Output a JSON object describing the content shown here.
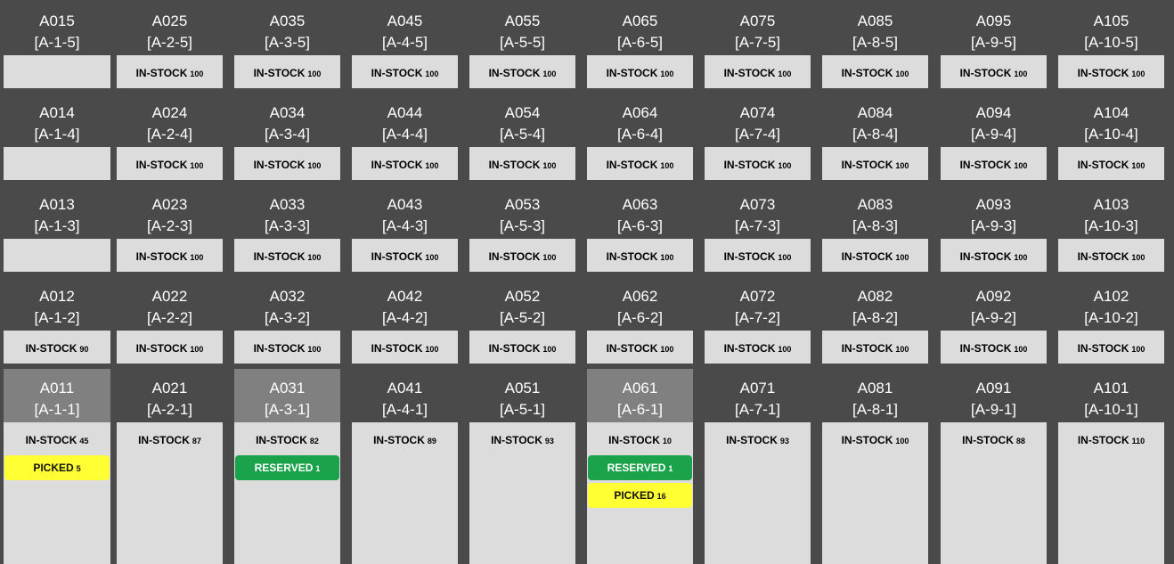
{
  "status_colors": {
    "in_stock": "#9ee8c6",
    "reserved": "#1aa34a",
    "picked": "#ffff33",
    "header_highlight": "#808080"
  },
  "rows": [
    [
      {
        "id": "A015",
        "loc": "[A-1-5]",
        "badges": []
      },
      {
        "id": "A025",
        "loc": "[A-2-5]",
        "badges": [
          {
            "type": "in-stock",
            "label": "IN-STOCK",
            "qty": "100"
          }
        ]
      },
      {
        "id": "A035",
        "loc": "[A-3-5]",
        "badges": [
          {
            "type": "in-stock",
            "label": "IN-STOCK",
            "qty": "100"
          }
        ]
      },
      {
        "id": "A045",
        "loc": "[A-4-5]",
        "badges": [
          {
            "type": "in-stock",
            "label": "IN-STOCK",
            "qty": "100"
          }
        ]
      },
      {
        "id": "A055",
        "loc": "[A-5-5]",
        "badges": [
          {
            "type": "in-stock",
            "label": "IN-STOCK",
            "qty": "100"
          }
        ]
      },
      {
        "id": "A065",
        "loc": "[A-6-5]",
        "badges": [
          {
            "type": "in-stock",
            "label": "IN-STOCK",
            "qty": "100"
          }
        ]
      },
      {
        "id": "A075",
        "loc": "[A-7-5]",
        "badges": [
          {
            "type": "in-stock",
            "label": "IN-STOCK",
            "qty": "100"
          }
        ]
      },
      {
        "id": "A085",
        "loc": "[A-8-5]",
        "badges": [
          {
            "type": "in-stock",
            "label": "IN-STOCK",
            "qty": "100"
          }
        ]
      },
      {
        "id": "A095",
        "loc": "[A-9-5]",
        "badges": [
          {
            "type": "in-stock",
            "label": "IN-STOCK",
            "qty": "100"
          }
        ]
      },
      {
        "id": "A105",
        "loc": "[A-10-5]",
        "badges": [
          {
            "type": "in-stock",
            "label": "IN-STOCK",
            "qty": "100"
          }
        ]
      }
    ],
    [
      {
        "id": "A014",
        "loc": "[A-1-4]",
        "badges": []
      },
      {
        "id": "A024",
        "loc": "[A-2-4]",
        "badges": [
          {
            "type": "in-stock",
            "label": "IN-STOCK",
            "qty": "100"
          }
        ]
      },
      {
        "id": "A034",
        "loc": "[A-3-4]",
        "badges": [
          {
            "type": "in-stock",
            "label": "IN-STOCK",
            "qty": "100"
          }
        ]
      },
      {
        "id": "A044",
        "loc": "[A-4-4]",
        "badges": [
          {
            "type": "in-stock",
            "label": "IN-STOCK",
            "qty": "100"
          }
        ]
      },
      {
        "id": "A054",
        "loc": "[A-5-4]",
        "badges": [
          {
            "type": "in-stock",
            "label": "IN-STOCK",
            "qty": "100"
          }
        ]
      },
      {
        "id": "A064",
        "loc": "[A-6-4]",
        "badges": [
          {
            "type": "in-stock",
            "label": "IN-STOCK",
            "qty": "100"
          }
        ]
      },
      {
        "id": "A074",
        "loc": "[A-7-4]",
        "badges": [
          {
            "type": "in-stock",
            "label": "IN-STOCK",
            "qty": "100"
          }
        ]
      },
      {
        "id": "A084",
        "loc": "[A-8-4]",
        "badges": [
          {
            "type": "in-stock",
            "label": "IN-STOCK",
            "qty": "100"
          }
        ]
      },
      {
        "id": "A094",
        "loc": "[A-9-4]",
        "badges": [
          {
            "type": "in-stock",
            "label": "IN-STOCK",
            "qty": "100"
          }
        ]
      },
      {
        "id": "A104",
        "loc": "[A-10-4]",
        "badges": [
          {
            "type": "in-stock",
            "label": "IN-STOCK",
            "qty": "100"
          }
        ]
      }
    ],
    [
      {
        "id": "A013",
        "loc": "[A-1-3]",
        "badges": []
      },
      {
        "id": "A023",
        "loc": "[A-2-3]",
        "badges": [
          {
            "type": "in-stock",
            "label": "IN-STOCK",
            "qty": "100"
          }
        ]
      },
      {
        "id": "A033",
        "loc": "[A-3-3]",
        "badges": [
          {
            "type": "in-stock",
            "label": "IN-STOCK",
            "qty": "100"
          }
        ]
      },
      {
        "id": "A043",
        "loc": "[A-4-3]",
        "badges": [
          {
            "type": "in-stock",
            "label": "IN-STOCK",
            "qty": "100"
          }
        ]
      },
      {
        "id": "A053",
        "loc": "[A-5-3]",
        "badges": [
          {
            "type": "in-stock",
            "label": "IN-STOCK",
            "qty": "100"
          }
        ]
      },
      {
        "id": "A063",
        "loc": "[A-6-3]",
        "badges": [
          {
            "type": "in-stock",
            "label": "IN-STOCK",
            "qty": "100"
          }
        ]
      },
      {
        "id": "A073",
        "loc": "[A-7-3]",
        "badges": [
          {
            "type": "in-stock",
            "label": "IN-STOCK",
            "qty": "100"
          }
        ]
      },
      {
        "id": "A083",
        "loc": "[A-8-3]",
        "badges": [
          {
            "type": "in-stock",
            "label": "IN-STOCK",
            "qty": "100"
          }
        ]
      },
      {
        "id": "A093",
        "loc": "[A-9-3]",
        "badges": [
          {
            "type": "in-stock",
            "label": "IN-STOCK",
            "qty": "100"
          }
        ]
      },
      {
        "id": "A103",
        "loc": "[A-10-3]",
        "badges": [
          {
            "type": "in-stock",
            "label": "IN-STOCK",
            "qty": "100"
          }
        ]
      }
    ],
    [
      {
        "id": "A012",
        "loc": "[A-1-2]",
        "badges": [
          {
            "type": "in-stock",
            "label": "IN-STOCK",
            "qty": "90"
          }
        ]
      },
      {
        "id": "A022",
        "loc": "[A-2-2]",
        "badges": [
          {
            "type": "in-stock",
            "label": "IN-STOCK",
            "qty": "100"
          }
        ]
      },
      {
        "id": "A032",
        "loc": "[A-3-2]",
        "badges": [
          {
            "type": "in-stock",
            "label": "IN-STOCK",
            "qty": "100"
          }
        ]
      },
      {
        "id": "A042",
        "loc": "[A-4-2]",
        "badges": [
          {
            "type": "in-stock",
            "label": "IN-STOCK",
            "qty": "100"
          }
        ]
      },
      {
        "id": "A052",
        "loc": "[A-5-2]",
        "badges": [
          {
            "type": "in-stock",
            "label": "IN-STOCK",
            "qty": "100"
          }
        ]
      },
      {
        "id": "A062",
        "loc": "[A-6-2]",
        "badges": [
          {
            "type": "in-stock",
            "label": "IN-STOCK",
            "qty": "100"
          }
        ]
      },
      {
        "id": "A072",
        "loc": "[A-7-2]",
        "badges": [
          {
            "type": "in-stock",
            "label": "IN-STOCK",
            "qty": "100"
          }
        ]
      },
      {
        "id": "A082",
        "loc": "[A-8-2]",
        "badges": [
          {
            "type": "in-stock",
            "label": "IN-STOCK",
            "qty": "100"
          }
        ]
      },
      {
        "id": "A092",
        "loc": "[A-9-2]",
        "badges": [
          {
            "type": "in-stock",
            "label": "IN-STOCK",
            "qty": "100"
          }
        ]
      },
      {
        "id": "A102",
        "loc": "[A-10-2]",
        "badges": [
          {
            "type": "in-stock",
            "label": "IN-STOCK",
            "qty": "100"
          }
        ]
      }
    ],
    [
      {
        "id": "A011",
        "loc": "[A-1-1]",
        "highlight": true,
        "badges": [
          {
            "type": "in-stock",
            "label": "IN-STOCK",
            "qty": "45"
          },
          {
            "type": "picked",
            "label": "PICKED",
            "qty": "5"
          }
        ]
      },
      {
        "id": "A021",
        "loc": "[A-2-1]",
        "badges": [
          {
            "type": "in-stock",
            "label": "IN-STOCK",
            "qty": "87"
          }
        ]
      },
      {
        "id": "A031",
        "loc": "[A-3-1]",
        "highlight": true,
        "badges": [
          {
            "type": "in-stock",
            "label": "IN-STOCK",
            "qty": "82"
          },
          {
            "type": "reserved",
            "label": "RESERVED",
            "qty": "1"
          }
        ]
      },
      {
        "id": "A041",
        "loc": "[A-4-1]",
        "badges": [
          {
            "type": "in-stock",
            "label": "IN-STOCK",
            "qty": "89"
          }
        ]
      },
      {
        "id": "A051",
        "loc": "[A-5-1]",
        "badges": [
          {
            "type": "in-stock",
            "label": "IN-STOCK",
            "qty": "93"
          }
        ]
      },
      {
        "id": "A061",
        "loc": "[A-6-1]",
        "highlight": true,
        "badges": [
          {
            "type": "in-stock",
            "label": "IN-STOCK",
            "qty": "10"
          },
          {
            "type": "reserved",
            "label": "RESERVED",
            "qty": "1"
          },
          {
            "type": "picked",
            "label": "PICKED",
            "qty": "16"
          }
        ]
      },
      {
        "id": "A071",
        "loc": "[A-7-1]",
        "badges": [
          {
            "type": "in-stock",
            "label": "IN-STOCK",
            "qty": "93"
          }
        ]
      },
      {
        "id": "A081",
        "loc": "[A-8-1]",
        "badges": [
          {
            "type": "in-stock",
            "label": "IN-STOCK",
            "qty": "100"
          }
        ]
      },
      {
        "id": "A091",
        "loc": "[A-9-1]",
        "badges": [
          {
            "type": "in-stock",
            "label": "IN-STOCK",
            "qty": "88"
          }
        ]
      },
      {
        "id": "A101",
        "loc": "[A-10-1]",
        "badges": [
          {
            "type": "in-stock",
            "label": "IN-STOCK",
            "qty": "110"
          }
        ]
      }
    ]
  ]
}
